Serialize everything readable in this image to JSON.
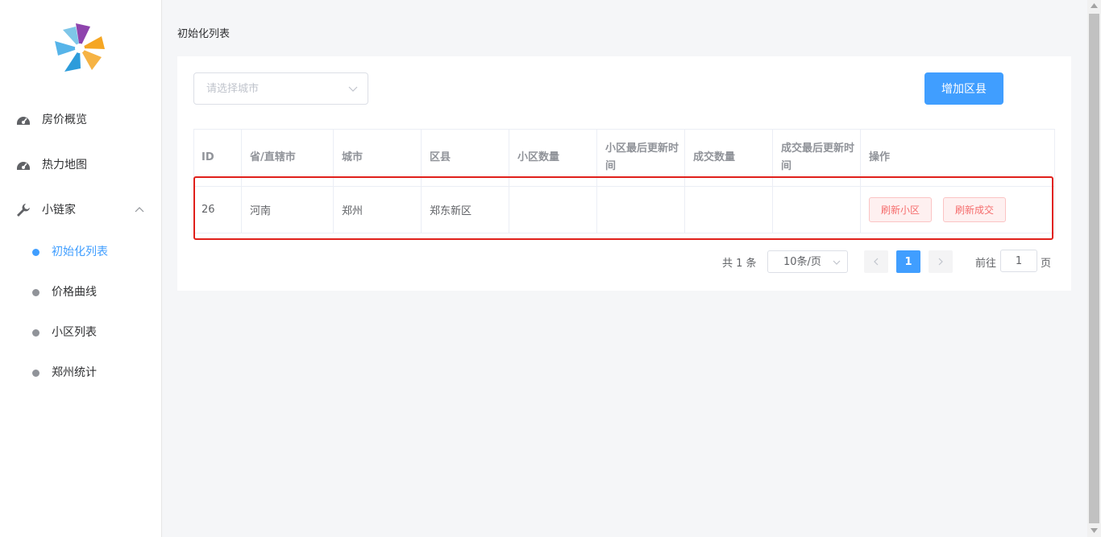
{
  "sidebar": {
    "menu": [
      {
        "label": "房价概览",
        "icon": "dashboard-icon"
      },
      {
        "label": "热力地图",
        "icon": "dashboard-icon"
      },
      {
        "label": "小链家",
        "icon": "wrench-icon"
      }
    ],
    "submenu": [
      {
        "label": "初始化列表",
        "active": true
      },
      {
        "label": "价格曲线",
        "active": false
      },
      {
        "label": "小区列表",
        "active": false
      },
      {
        "label": "郑州统计",
        "active": false
      }
    ]
  },
  "breadcrumb": "初始化列表",
  "toolbar": {
    "city_select_placeholder": "请选择城市",
    "add_button": "增加区县"
  },
  "table": {
    "columns": [
      "ID",
      "省/直辖市",
      "城市",
      "区县",
      "小区数量",
      "小区最后更新时间",
      "成交数量",
      "成交最后更新时间",
      "操作"
    ],
    "rows": [
      {
        "id": "26",
        "province": "河南",
        "city": "郑州",
        "district": "郑东新区",
        "community_count": "",
        "community_updated": "",
        "deal_count": "",
        "deal_updated": "",
        "actions": [
          "刷新小区",
          "刷新成交"
        ]
      }
    ]
  },
  "pagination": {
    "total": "共 1 条",
    "page_size": "10条/页",
    "current_page": "1",
    "goto_label": "前往",
    "goto_value": "1",
    "goto_suffix": "页"
  },
  "colors": {
    "primary": "#409eff",
    "danger": "#f56c6c",
    "highlight": "#e0201b"
  }
}
